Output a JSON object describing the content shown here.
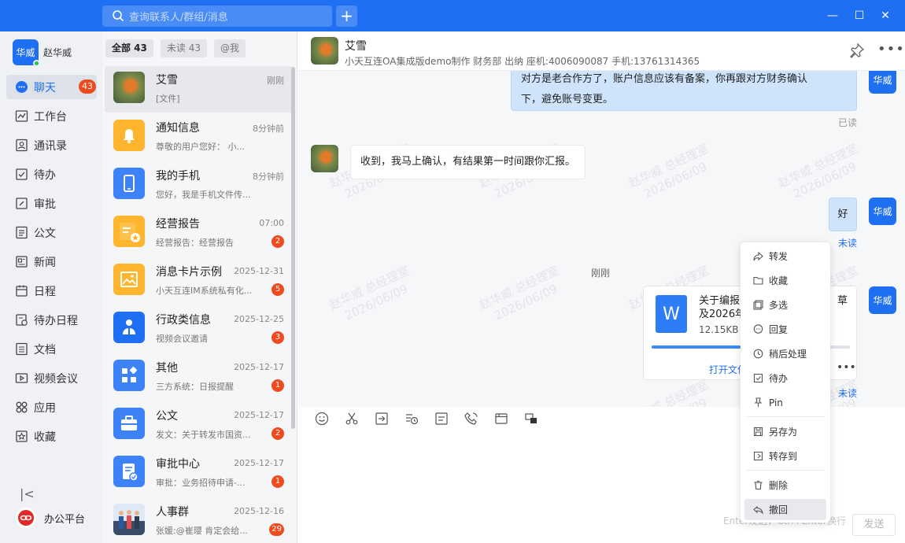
{
  "search": {
    "placeholder": "查询联系人/群组/消息",
    "add": "+"
  },
  "window": {
    "minimize": "—",
    "maximize": "☐",
    "close": "✕"
  },
  "user": {
    "avatar": "华威",
    "name": "赵华威"
  },
  "nav": [
    {
      "label": "聊天",
      "badge": "43"
    },
    {
      "label": "工作台"
    },
    {
      "label": "通讯录"
    },
    {
      "label": "待办"
    },
    {
      "label": "审批"
    },
    {
      "label": "公文"
    },
    {
      "label": "新闻"
    },
    {
      "label": "日程"
    },
    {
      "label": "待办日程"
    },
    {
      "label": "文档"
    },
    {
      "label": "视频会议"
    },
    {
      "label": "应用"
    },
    {
      "label": "收藏"
    }
  ],
  "collapse_icon": "|<",
  "platform": "办公平台",
  "filters": [
    {
      "label": "全部 43"
    },
    {
      "label": "未读 43"
    },
    {
      "label": "@我"
    }
  ],
  "conversations": [
    {
      "title": "艾雪",
      "time": "刚刚",
      "preview": "[文件]",
      "badge": ""
    },
    {
      "title": "通知信息",
      "time": "8分钟前",
      "preview": "尊敬的用户您好：  小...",
      "badge": ""
    },
    {
      "title": "我的手机",
      "time": "8分钟前",
      "preview": "您好，我是手机文件传...",
      "badge": ""
    },
    {
      "title": "经营报告",
      "time": "07:00",
      "preview": "经营报告：经营报告",
      "badge": "2"
    },
    {
      "title": "消息卡片示例",
      "time": "2025-12-31",
      "preview": "小天互连IM系统私有化...",
      "badge": "5"
    },
    {
      "title": "行政类信息",
      "time": "2025-12-25",
      "preview": "视频会议邀请",
      "badge": "3"
    },
    {
      "title": "其他",
      "time": "2025-12-17",
      "preview": "三方系统：日报提醒",
      "badge": "1"
    },
    {
      "title": "公文",
      "time": "2025-12-17",
      "preview": "发文：关于转发市国资...",
      "badge": "2"
    },
    {
      "title": "审批中心",
      "time": "2025-12-17",
      "preview": "审批：业务招待申请-...",
      "badge": "1"
    },
    {
      "title": "人事群",
      "time": "2025-12-16",
      "preview": "张媛:@崔璎 肯定会给...",
      "badge": "29"
    }
  ],
  "chat": {
    "name": "艾雪",
    "subtitle": "小天互连OA集成版demo制作  财务部  出纳  座机:4006090087  手机:13761314365",
    "watermark_name": "赵华威 总经理室",
    "watermark_date": "2026/06/09",
    "messages": [
      {
        "side": "right",
        "text_line1": "对方是老合作方了，账户信息应该有备案，你再跟对方财务确认",
        "text_line2": "下，避免账号变更。",
        "status": "已读"
      },
      {
        "side": "left",
        "text": "收到，我马上确认，有结果第一时间跟你汇报。"
      },
      {
        "side": "right",
        "text": "好",
        "status": "未读"
      }
    ],
    "time_divider": "刚刚",
    "file": {
      "title_line1": "关于编报",
      "title_line2": "及2026年",
      "title_tail": "草",
      "size": "12.15KB",
      "progress": 0.45,
      "open": "打开文件",
      "more": "•••",
      "status": "未读",
      "icon": "W"
    },
    "input_hint": "Enter发送，Ctrl+Enter换行",
    "send": "发送"
  },
  "context_menu": [
    {
      "label": "转发",
      "icon": "forward-icon"
    },
    {
      "label": "收藏",
      "icon": "folder-icon"
    },
    {
      "label": "多选",
      "icon": "multi-select-icon"
    },
    {
      "label": "回复",
      "icon": "reply-icon"
    },
    {
      "label": "稍后处理",
      "icon": "clock-icon"
    },
    {
      "label": "待办",
      "icon": "todo-icon"
    },
    {
      "label": "Pin",
      "icon": "pin-icon"
    },
    {
      "label": "另存为",
      "icon": "save-icon"
    },
    {
      "label": "转存到",
      "icon": "transfer-icon"
    },
    {
      "label": "删除",
      "icon": "trash-icon"
    },
    {
      "label": "撤回",
      "icon": "recall-icon"
    }
  ],
  "colors": {
    "brand": "#1f6ff2",
    "badge": "#f04a1f",
    "bubble_self": "#cfe3fb"
  }
}
